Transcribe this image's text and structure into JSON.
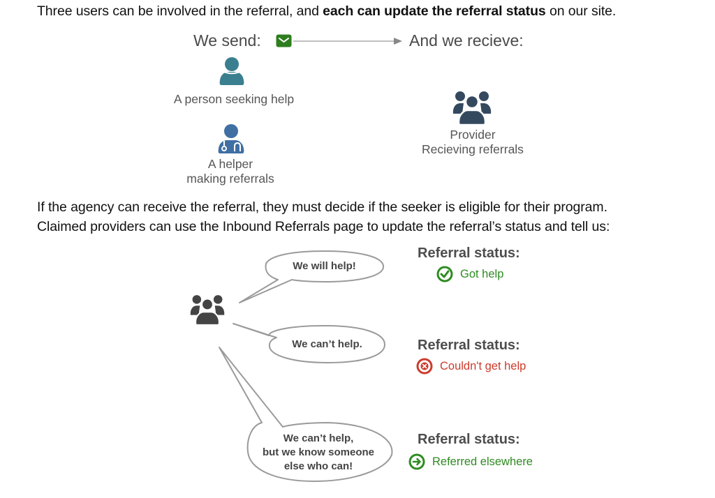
{
  "intro": {
    "before_bold": "Three users can be involved in the referral, and ",
    "bold": "each can update the referral status",
    "after_bold": " on our site."
  },
  "flow": {
    "send_label": "We send:",
    "receive_label": "And we recieve:",
    "send_icon": "envelope-icon",
    "send_icon_color": "#2e7d1f"
  },
  "senders": [
    {
      "icon": "person-icon",
      "color": "#3a7f8f",
      "label_lines": [
        "A person seeking help"
      ]
    },
    {
      "icon": "doctor-icon",
      "color": "#3f6fa3",
      "label_lines": [
        "A helper",
        "making referrals"
      ]
    }
  ],
  "receiver": {
    "icon": "group-icon",
    "color": "#34495e",
    "label_lines": [
      "Provider",
      "Recieving referrals"
    ]
  },
  "explain": {
    "line1": "If the agency can receive the referral, they must decide if the seeker is eligible for their program.",
    "line2": "Claimed providers can use the Inbound Referrals page to update the referral’s status and tell us:"
  },
  "provider_icon": {
    "icon": "group-icon",
    "color": "#444444"
  },
  "responses": [
    {
      "bubble_lines": [
        "We will help!"
      ],
      "status_title": "Referral status:",
      "status_label": "Got help",
      "status_icon": "check-circle-icon",
      "status_color": "#2e8b22"
    },
    {
      "bubble_lines": [
        "We can’t help."
      ],
      "status_title": "Referral status:",
      "status_label": "Couldn't get help",
      "status_icon": "x-circle-icon",
      "status_color": "#cc3b2b"
    },
    {
      "bubble_lines": [
        "We can’t help,",
        "but we know someone",
        "else who can!"
      ],
      "status_title": "Referral status:",
      "status_label": "Referred elsewhere",
      "status_icon": "arrow-circle-icon",
      "status_color": "#2e8b22"
    }
  ]
}
